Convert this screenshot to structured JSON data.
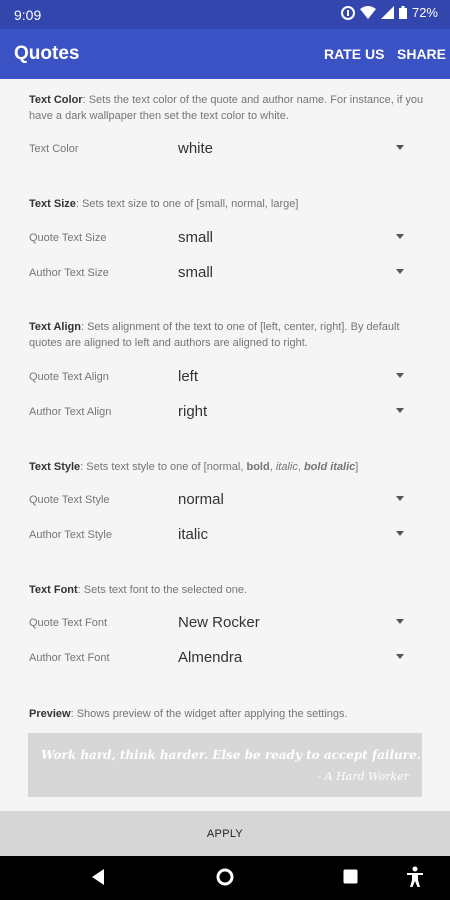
{
  "status_bar": {
    "time": "9:09",
    "battery": "72%"
  },
  "app_bar": {
    "title": "Quotes",
    "rate_us": "RATE US",
    "share": "SHARE"
  },
  "sections": {
    "color": {
      "desc_title": "Text Color",
      "desc_text": ": Sets the text color of the quote and author name. For instance, if you have a dark wallpaper then set the text color to white.",
      "rows": [
        {
          "label": "Text Color",
          "value": "white"
        }
      ]
    },
    "size": {
      "desc_title": "Text Size",
      "desc_text": ": Sets text size to one of [small, normal, large]",
      "rows": [
        {
          "label": "Quote Text Size",
          "value": "small"
        },
        {
          "label": "Author Text Size",
          "value": "small"
        }
      ]
    },
    "align": {
      "desc_title": "Text Align",
      "desc_text": ": Sets alignment of the text to one of [left, center, right]. By default quotes are aligned to left and authors are aligned to right.",
      "rows": [
        {
          "label": "Quote Text Align",
          "value": "left"
        },
        {
          "label": "Author Text Align",
          "value": "right"
        }
      ]
    },
    "style": {
      "desc_title": "Text Style",
      "desc_pre": ": Sets text style to one of [normal, ",
      "opt_bold": "bold",
      "sep1": ", ",
      "opt_italic": "italic",
      "sep2": ", ",
      "opt_bold_italic": "bold italic",
      "desc_post": "]",
      "rows": [
        {
          "label": "Quote Text Style",
          "value": "normal"
        },
        {
          "label": "Author Text Style",
          "value": "italic"
        }
      ]
    },
    "font": {
      "desc_title": "Text Font",
      "desc_text": ": Sets text font to the selected one.",
      "rows": [
        {
          "label": "Quote Text Font",
          "value": "New Rocker"
        },
        {
          "label": "Author Text Font",
          "value": "Almendra"
        }
      ]
    },
    "preview": {
      "desc_title": "Preview",
      "desc_text": ": Shows preview of the widget after applying the settings.",
      "quote": "Work hard, think harder. Else be ready to accept failure.",
      "author": "- A Hard Worker"
    }
  },
  "apply_label": "APPLY",
  "colors": {
    "status_bar": "#3346ad",
    "app_bar": "#3b52c4",
    "background": "#f5f5f5",
    "preview_bg": "#d7d7d7",
    "apply_bar": "#d6d6d6"
  }
}
